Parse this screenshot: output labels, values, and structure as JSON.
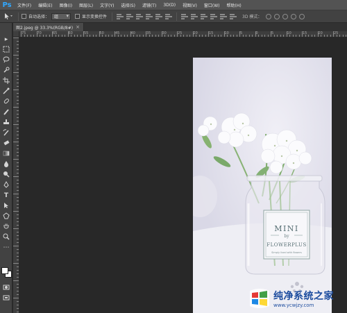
{
  "app": {
    "logo": "Ps"
  },
  "menu": [
    "文件(F)",
    "编辑(E)",
    "图像(I)",
    "图层(L)",
    "文字(Y)",
    "选择(S)",
    "滤镜(T)",
    "3D(D)",
    "视图(V)",
    "窗口(W)",
    "帮助(H)"
  ],
  "options": {
    "tool_icon": "move-tool-icon",
    "auto_select_label": "自动选择：",
    "auto_select_value": "组",
    "transform_label": "显示变换控件",
    "mode_label": "3D 模式："
  },
  "document": {
    "tab_title": "图2.jpeg @ 33.3%(RGB/8#)",
    "close_symbol": "×"
  },
  "ruler": {
    "h_labels": [
      "75",
      "70",
      "65",
      "60",
      "55",
      "50",
      "45",
      "40",
      "35",
      "30",
      "25",
      "20",
      "15",
      "10",
      "5",
      "0",
      "5",
      "10",
      "15",
      "20",
      "25"
    ]
  },
  "photo": {
    "label_line1": "MINI",
    "label_line2": "by",
    "label_line3": "FLOWERPLUS",
    "label_small": "Simply lived with flowers"
  },
  "watermark": {
    "title": "纯净系统之家",
    "url": "www.ycwjzy.com"
  },
  "colors": {
    "menubar": "#535353",
    "panel": "#424242",
    "workspace": "#282828",
    "ps_blue": "#31a8ff",
    "watermark_blue": "#1c4c9e"
  }
}
